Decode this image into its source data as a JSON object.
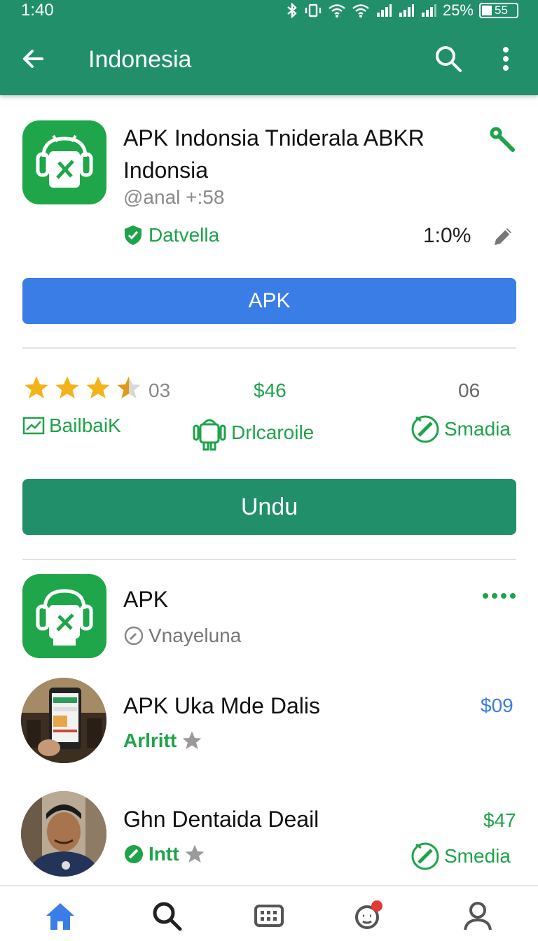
{
  "status": {
    "time": "1:40",
    "battery": "25%",
    "battery_level": "55"
  },
  "appbar": {
    "title": "Indonesia"
  },
  "app": {
    "name": "APK Indonsia Tniderala ABKR Indonsia",
    "developer": "@anal +:58",
    "verified_label": "Datvella",
    "percent": "1:0%",
    "apk_button": "APK"
  },
  "stats": {
    "rating": 3.5,
    "rating_value": "03",
    "price": "$46",
    "count": "06",
    "labels": [
      "BailbaiK",
      "Drlcaroile",
      "Smadia"
    ]
  },
  "download_button": "Undu",
  "list": [
    {
      "title": "APK",
      "sub": "Vnayeluna"
    },
    {
      "title": "APK Uka Mde Dalis",
      "sub": "Arlritt",
      "price": "$09"
    },
    {
      "title": "Ghn Dentaida Deail",
      "sub": "Intt",
      "price": "$47",
      "badge": "Smedia"
    }
  ],
  "colors": {
    "primary": "#21906a",
    "blue": "#3a7de6",
    "green": "#1ea34a",
    "star": "#f2b31b"
  }
}
